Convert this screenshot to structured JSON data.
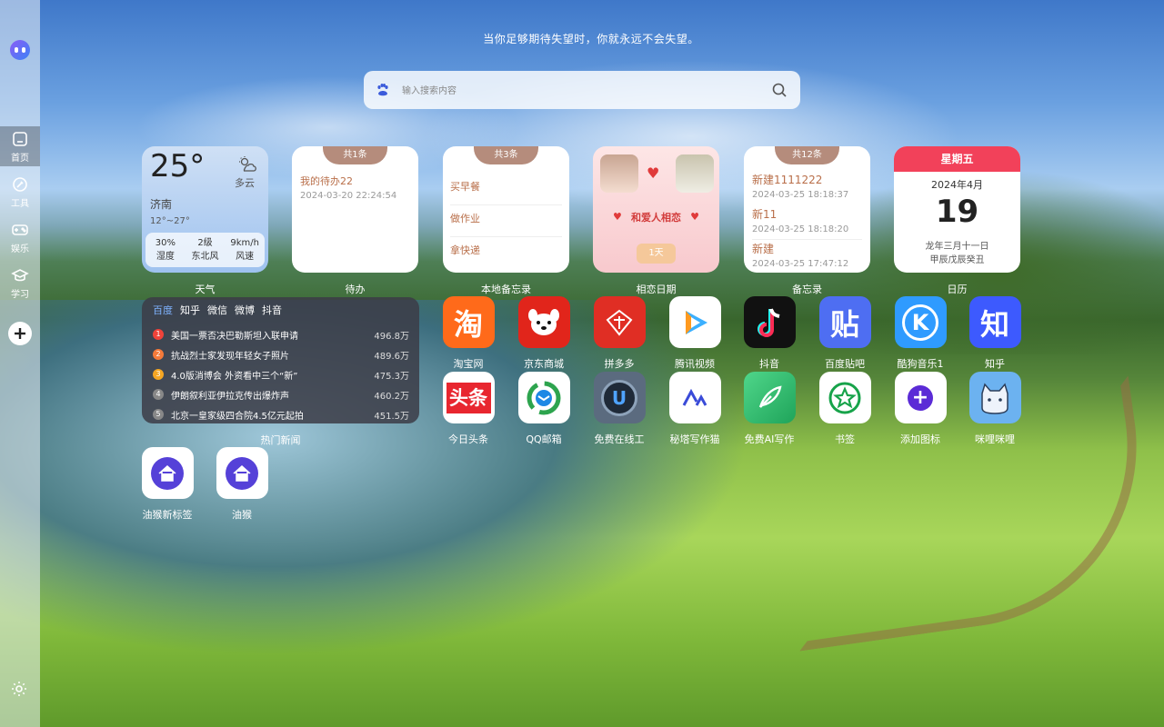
{
  "sidebar": {
    "items": [
      {
        "label": "首页",
        "icon": "home-icon"
      },
      {
        "label": "工具",
        "icon": "tool-icon"
      },
      {
        "label": "娱乐",
        "icon": "gamepad-icon"
      },
      {
        "label": "学习",
        "icon": "graduation-cap-icon"
      }
    ]
  },
  "motto": "当你足够期待失望时，你就永远不会失望。",
  "search": {
    "placeholder": "输入搜索内容",
    "value": ""
  },
  "weather": {
    "temp": "25°",
    "condition": "多云",
    "city": "济南",
    "range": "12°~27°",
    "humidity": "30%",
    "humidity_label": "湿度",
    "wind_level": "2级",
    "wind_dir": "东北风",
    "wind_speed": "9km/h",
    "wind_speed_label": "风速",
    "label": "天气"
  },
  "todo": {
    "badge": "共1条",
    "title": "我的待办22",
    "time": "2024-03-20 22:24:54",
    "label": "待办"
  },
  "local_memo": {
    "badge": "共3条",
    "items": [
      "买早餐",
      "做作业",
      "拿快递"
    ],
    "label": "本地备忘录"
  },
  "love_date": {
    "text": "和爱人相恋",
    "days": "1天",
    "label": "相恋日期"
  },
  "memo": {
    "badge": "共12条",
    "items": [
      {
        "title": "新建1111222",
        "date": "2024-03-25 18:18:37"
      },
      {
        "title": "新11",
        "date": "2024-03-25 18:18:20"
      },
      {
        "title": "新建",
        "date": "2024-03-25 17:47:12"
      }
    ],
    "label": "备忘录"
  },
  "calendar": {
    "weekday": "星期五",
    "year_month": "2024年4月",
    "day": "19",
    "lunar": "龙年三月十一日",
    "ganzhi": "甲辰戊辰癸丑",
    "label": "日历"
  },
  "news": {
    "tabs": [
      "百度",
      "知乎",
      "微信",
      "微博",
      "抖音"
    ],
    "items": [
      {
        "rank": "1",
        "title": "美国一票否决巴勒斯坦入联申请",
        "count": "496.8万"
      },
      {
        "rank": "2",
        "title": "抗战烈士家发现年轻女子照片",
        "count": "489.6万"
      },
      {
        "rank": "3",
        "title": "4.0版消博会 外资看中三个“新”",
        "count": "475.3万"
      },
      {
        "rank": "4",
        "title": "伊朗叙利亚伊拉克传出爆炸声",
        "count": "460.2万"
      },
      {
        "rank": "5",
        "title": "北京一皇家级四合院4.5亿元起拍",
        "count": "451.5万"
      }
    ],
    "label": "热门新闻"
  },
  "apps_row1": [
    {
      "label": "淘宝网",
      "glyph": "淘",
      "bg": "#ff6a1a"
    },
    {
      "label": "京东商城",
      "glyph": "",
      "bg": "#e1251b"
    },
    {
      "label": "拼多多",
      "glyph": "",
      "bg": "#e02e24"
    },
    {
      "label": "腾讯视频",
      "glyph": "",
      "bg": "#ffffff"
    },
    {
      "label": "抖音",
      "glyph": "",
      "bg": "#111111"
    },
    {
      "label": "百度贴吧",
      "glyph": "贴",
      "bg": "#4e6ef2"
    },
    {
      "label": "酷狗音乐1",
      "glyph": "K",
      "bg": "#2f9bff"
    },
    {
      "label": "知乎",
      "glyph": "知",
      "bg": "#3d5afe"
    }
  ],
  "apps_row2": [
    {
      "label": "今日头条",
      "glyph": "头条",
      "bg": "#ffffff"
    },
    {
      "label": "QQ邮箱",
      "glyph": "",
      "bg": "#ffffff"
    },
    {
      "label": "免费在线工",
      "glyph": "U",
      "bg": "#5b6b7f"
    },
    {
      "label": "秘塔写作猫",
      "glyph": "",
      "bg": "#ffffff"
    },
    {
      "label": "免费AI写作",
      "glyph": "",
      "bg": "#3dbb6c"
    },
    {
      "label": "书签",
      "glyph": "",
      "bg": "#ffffff"
    },
    {
      "label": "添加图标",
      "glyph": "+",
      "bg": "#ffffff"
    },
    {
      "label": "咪哩咪哩",
      "glyph": "",
      "bg": "#6cb2f0"
    }
  ],
  "apps_row3": [
    {
      "label": "油猴新标签",
      "bg": "#ffffff"
    },
    {
      "label": "油猴",
      "bg": "#ffffff"
    }
  ]
}
